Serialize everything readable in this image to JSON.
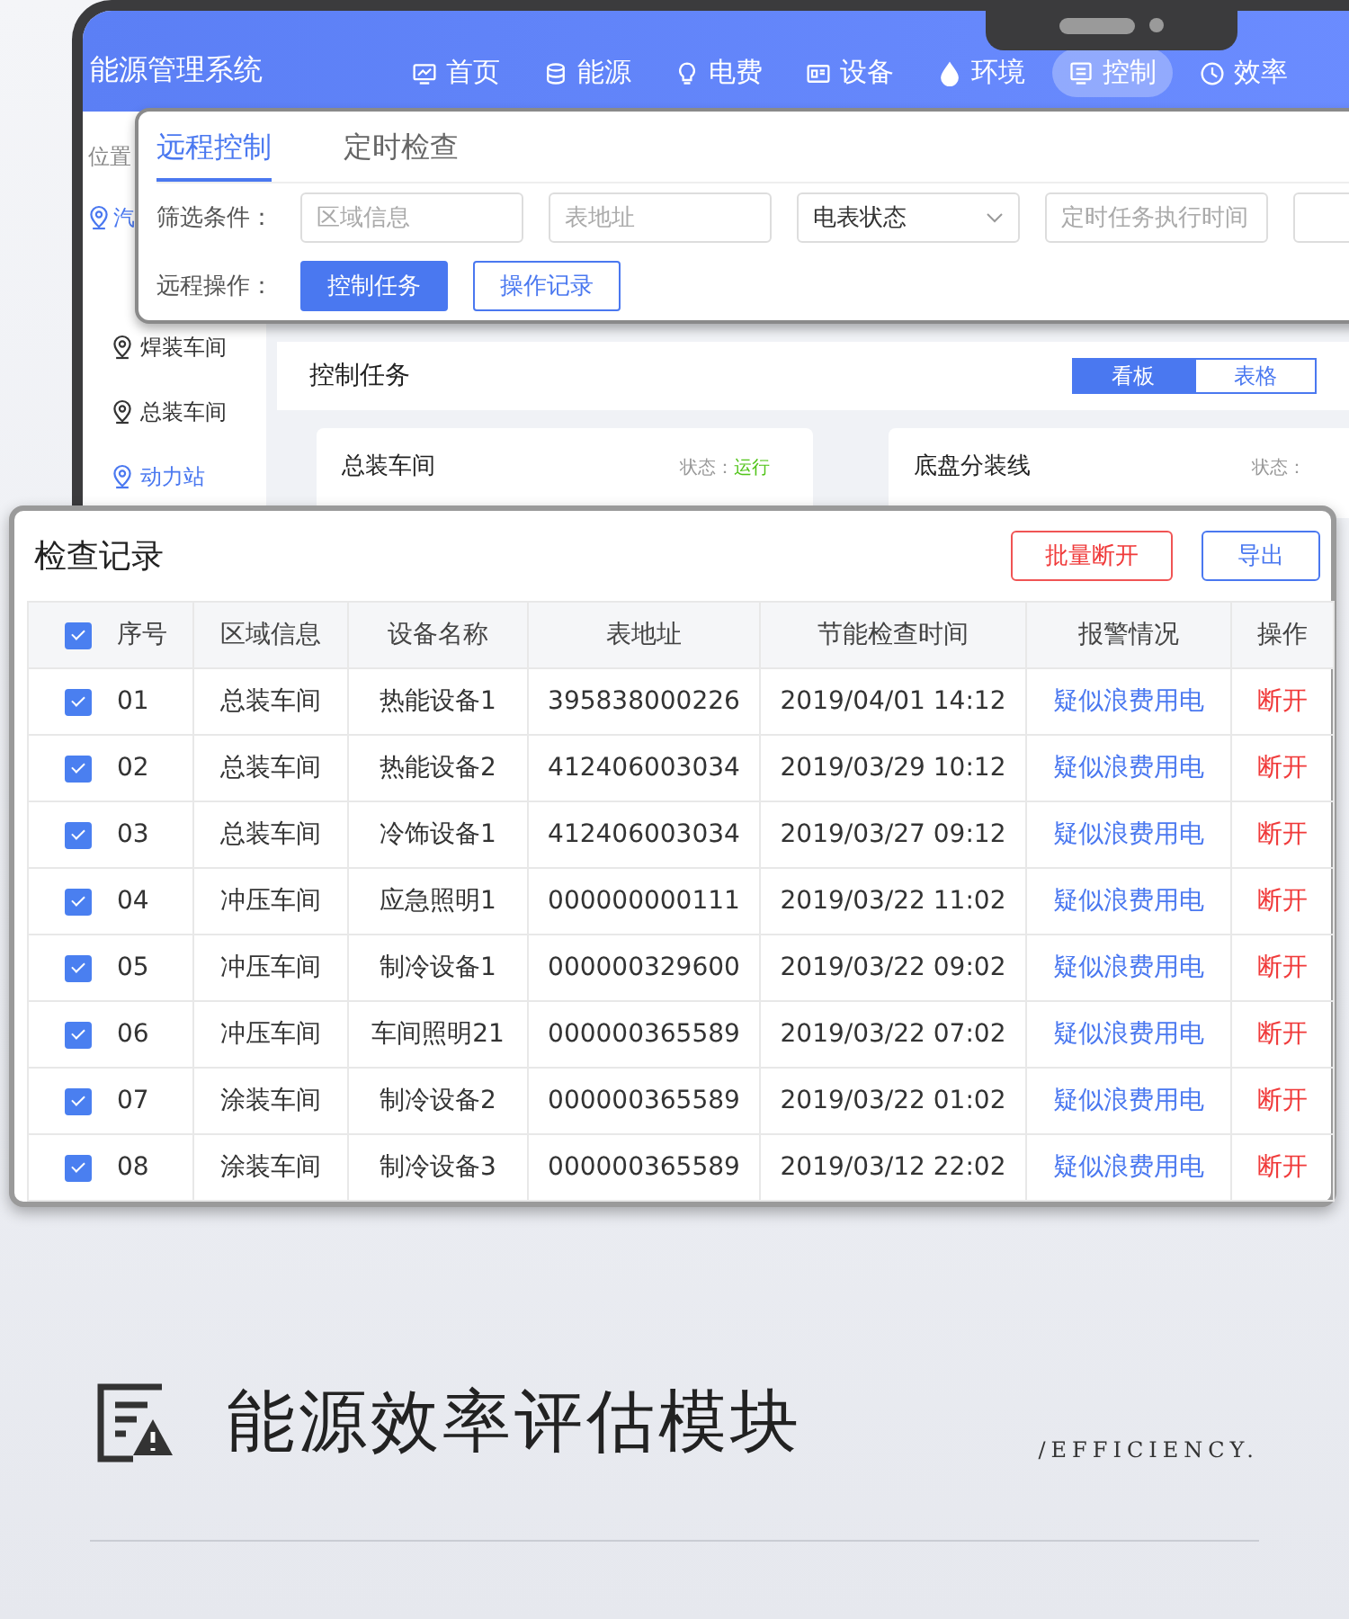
{
  "nav": {
    "title": "能源管理系统",
    "items": [
      {
        "label": "首页",
        "selected": false
      },
      {
        "label": "能源",
        "selected": false
      },
      {
        "label": "电费",
        "selected": false
      },
      {
        "label": "设备",
        "selected": false
      },
      {
        "label": "环境",
        "selected": false
      },
      {
        "label": "控制",
        "selected": true
      },
      {
        "label": "效率",
        "selected": false
      }
    ]
  },
  "sidebar": {
    "heading": "位置",
    "items": [
      {
        "label": "汽",
        "selected": true
      },
      {
        "label": "焊装车间",
        "selected": false
      },
      {
        "label": "总装车间",
        "selected": false
      },
      {
        "label": "动力站",
        "selected": true
      }
    ]
  },
  "control_panel": {
    "tabs": [
      {
        "label": "远程控制",
        "selected": true
      },
      {
        "label": "定时检查",
        "selected": false
      }
    ],
    "filter_label": "筛选条件：",
    "filters": [
      {
        "kind": "input",
        "placeholder": "区域信息"
      },
      {
        "kind": "input",
        "placeholder": "表地址"
      },
      {
        "kind": "select",
        "value": "电表状态"
      },
      {
        "kind": "input",
        "placeholder": "定时任务执行时间"
      }
    ],
    "actions_label": "远程操作：",
    "actions": [
      {
        "label": "控制任务",
        "selected": true
      },
      {
        "label": "操作记录",
        "selected": false
      }
    ]
  },
  "tasks": {
    "title": "控制任务",
    "views": [
      {
        "label": "看板",
        "selected": true
      },
      {
        "label": "表格",
        "selected": false
      }
    ],
    "cards": [
      {
        "name": "总装车间",
        "status_label": "状态：",
        "status": "运行"
      },
      {
        "name": "底盘分装线",
        "status_label": "状态："
      }
    ]
  },
  "records": {
    "title": "检查记录",
    "buttons": [
      {
        "label": "批量断开",
        "kind": "danger"
      },
      {
        "label": "导出",
        "kind": "primary"
      }
    ],
    "all_checked": true,
    "columns": [
      "序号",
      "区域信息",
      "设备名称",
      "表地址",
      "节能检查时间",
      "报警情况",
      "操作"
    ],
    "rows": [
      {
        "checked": true,
        "cells": [
          "01",
          "总装车间",
          "热能设备1",
          "395838000226",
          "2019/04/01 14:12",
          "疑似浪费用电",
          "断开"
        ]
      },
      {
        "checked": true,
        "cells": [
          "02",
          "总装车间",
          "热能设备2",
          "412406003034",
          "2019/03/29 10:12",
          "疑似浪费用电",
          "断开"
        ]
      },
      {
        "checked": true,
        "cells": [
          "03",
          "总装车间",
          "冷饰设备1",
          "412406003034",
          "2019/03/27 09:12",
          "疑似浪费用电",
          "断开"
        ]
      },
      {
        "checked": true,
        "cells": [
          "04",
          "冲压车间",
          "应急照明1",
          "000000000111",
          "2019/03/22 11:02",
          "疑似浪费用电",
          "断开"
        ]
      },
      {
        "checked": true,
        "cells": [
          "05",
          "冲压车间",
          "制冷设备1",
          "000000329600",
          "2019/03/22 09:02",
          "疑似浪费用电",
          "断开"
        ]
      },
      {
        "checked": true,
        "cells": [
          "06",
          "冲压车间",
          "车间照明21",
          "000000365589",
          "2019/03/22 07:02",
          "疑似浪费用电",
          "断开"
        ]
      },
      {
        "checked": true,
        "cells": [
          "07",
          "涂装车间",
          "制冷设备2",
          "000000365589",
          "2019/03/22 01:02",
          "疑似浪费用电",
          "断开"
        ]
      },
      {
        "checked": true,
        "cells": [
          "08",
          "涂装车间",
          "制冷设备3",
          "000000365589",
          "2019/03/12 22:02",
          "疑似浪费用电",
          "断开"
        ]
      }
    ]
  },
  "footer": {
    "title": "能源效率评估模块",
    "subtitle": "/EFFICIENCY."
  }
}
